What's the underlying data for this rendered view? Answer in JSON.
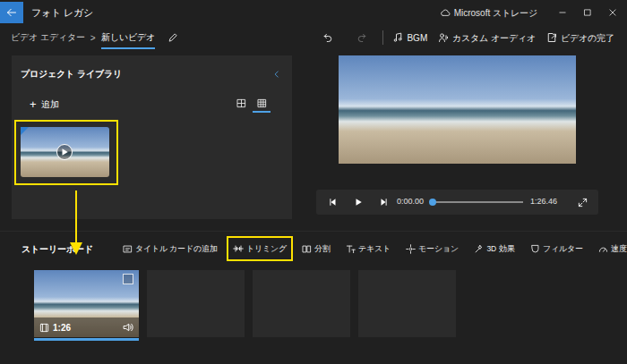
{
  "window": {
    "title": "フォト レガシ",
    "storage": "Microsoft ストレージ"
  },
  "breadcrumb": [
    {
      "label": "ビデオ エディター",
      "selected": false
    },
    {
      "label": "新しいビデオ",
      "selected": true
    }
  ],
  "breadcrumb_separator": ">",
  "history": [
    {
      "kind": "undo",
      "disabled": false
    },
    {
      "kind": "redo",
      "disabled": true
    }
  ],
  "actions": [
    {
      "label": "BGM"
    },
    {
      "label": "カスタム オーディオ"
    },
    {
      "label": "ビデオの完了"
    }
  ],
  "library": {
    "title": "プロジェクト ライブラリ",
    "add_icon": "+",
    "add": "追加",
    "views": [
      {
        "kind": "large",
        "selected": false
      },
      {
        "kind": "small",
        "selected": true
      }
    ],
    "items": [
      {
        "highlighted": true,
        "in_use": true
      }
    ]
  },
  "preview": {
    "current": "0:00.00",
    "total": "1:26.46",
    "level": 0
  },
  "storyboard": {
    "title": "ストーリーボード",
    "tools": [
      {
        "label": "タイトル カードの追加",
        "highlighted": false
      },
      {
        "label": "トリミング",
        "highlighted": true
      },
      {
        "label": "分割",
        "highlighted": false
      },
      {
        "label": "テキスト",
        "highlighted": false
      },
      {
        "label": "モーション",
        "highlighted": false
      },
      {
        "label": "3D 効果",
        "highlighted": false
      },
      {
        "label": "フィルター",
        "highlighted": false
      },
      {
        "label": "速度",
        "highlighted": false
      }
    ],
    "more": "···",
    "clips": [
      {
        "kind": "video",
        "duration": "1:26",
        "selected": true,
        "checked": false
      },
      {
        "kind": "empty",
        "selected": false
      },
      {
        "kind": "empty",
        "selected": false
      },
      {
        "kind": "empty",
        "selected": false
      }
    ]
  }
}
